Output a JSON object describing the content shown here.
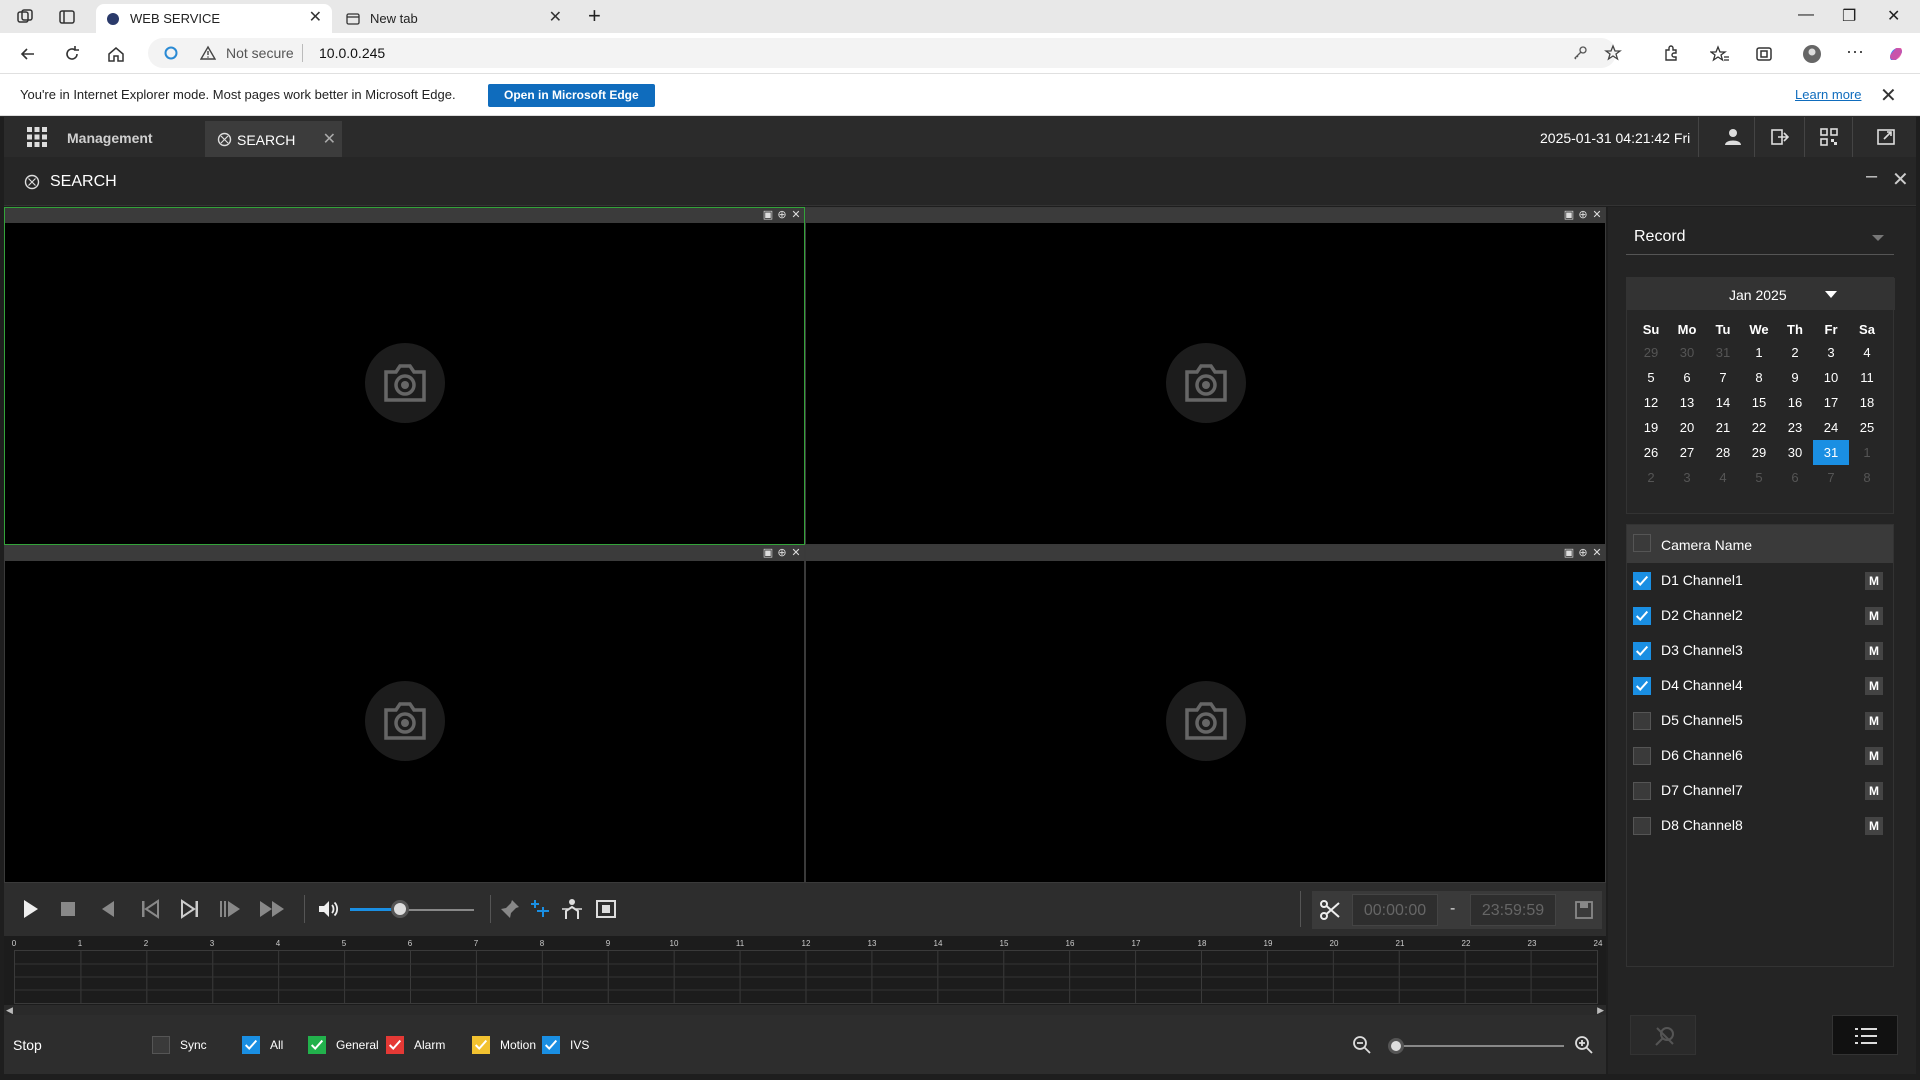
{
  "browser": {
    "tabs": [
      {
        "label": "WEB SERVICE"
      },
      {
        "label": "New tab"
      }
    ],
    "address": {
      "security": "Not secure",
      "url": "10.0.0.245"
    },
    "ie_bar": {
      "message": "You're in Internet Explorer mode. Most pages work better in Microsoft Edge.",
      "open_button": "Open in Microsoft Edge",
      "learn_more": "Learn more"
    }
  },
  "app": {
    "nav_label": "Management",
    "search_tab": "SEARCH",
    "datetime": "2025-01-31 04:21:42 Fri",
    "panel_title": "SEARCH"
  },
  "playback": {
    "start_time": "00:00:00",
    "separator": "-",
    "end_time": "23:59:59",
    "volume_fraction": 0.4,
    "status": "Stop"
  },
  "timeline": {
    "hour_labels": [
      "0",
      "1",
      "2",
      "3",
      "4",
      "5",
      "6",
      "7",
      "8",
      "9",
      "10",
      "11",
      "12",
      "13",
      "14",
      "15",
      "16",
      "17",
      "18",
      "19",
      "20",
      "21",
      "22",
      "23",
      "24"
    ]
  },
  "filters": [
    {
      "label": "Sync",
      "checked": false,
      "color": "#3a3a3a"
    },
    {
      "label": "All",
      "checked": true,
      "color": "#1a8fe3"
    },
    {
      "label": "General",
      "checked": true,
      "color": "#22b14c"
    },
    {
      "label": "Alarm",
      "checked": true,
      "color": "#e53935"
    },
    {
      "label": "Motion",
      "checked": true,
      "color": "#f2c230"
    },
    {
      "label": "IVS",
      "checked": true,
      "color": "#1a8fe3"
    }
  ],
  "right_panel": {
    "record_type": "Record",
    "month": "Jan 2025",
    "weekdays": [
      "Su",
      "Mo",
      "Tu",
      "We",
      "Th",
      "Fr",
      "Sa"
    ],
    "days": [
      {
        "d": "29",
        "o": true
      },
      {
        "d": "30",
        "o": true
      },
      {
        "d": "31",
        "o": true
      },
      {
        "d": "1"
      },
      {
        "d": "2"
      },
      {
        "d": "3"
      },
      {
        "d": "4"
      },
      {
        "d": "5"
      },
      {
        "d": "6"
      },
      {
        "d": "7"
      },
      {
        "d": "8"
      },
      {
        "d": "9"
      },
      {
        "d": "10"
      },
      {
        "d": "11"
      },
      {
        "d": "12"
      },
      {
        "d": "13"
      },
      {
        "d": "14"
      },
      {
        "d": "15"
      },
      {
        "d": "16"
      },
      {
        "d": "17"
      },
      {
        "d": "18"
      },
      {
        "d": "19"
      },
      {
        "d": "20"
      },
      {
        "d": "21"
      },
      {
        "d": "22"
      },
      {
        "d": "23"
      },
      {
        "d": "24"
      },
      {
        "d": "25"
      },
      {
        "d": "26"
      },
      {
        "d": "27"
      },
      {
        "d": "28"
      },
      {
        "d": "29"
      },
      {
        "d": "30"
      },
      {
        "d": "31",
        "sel": true
      },
      {
        "d": "1",
        "o": true
      },
      {
        "d": "2",
        "o": true
      },
      {
        "d": "3",
        "o": true
      },
      {
        "d": "4",
        "o": true
      },
      {
        "d": "5",
        "o": true
      },
      {
        "d": "6",
        "o": true
      },
      {
        "d": "7",
        "o": true
      },
      {
        "d": "8",
        "o": true
      }
    ],
    "camera_header": "Camera Name",
    "cameras": [
      {
        "name": "D1 Channel1",
        "checked": true,
        "m": "M"
      },
      {
        "name": "D2 Channel2",
        "checked": true,
        "m": "M"
      },
      {
        "name": "D3 Channel3",
        "checked": true,
        "m": "M"
      },
      {
        "name": "D4 Channel4",
        "checked": true,
        "m": "M"
      },
      {
        "name": "D5 Channel5",
        "checked": false,
        "m": "M"
      },
      {
        "name": "D6 Channel6",
        "checked": false,
        "m": "M"
      },
      {
        "name": "D7 Channel7",
        "checked": false,
        "m": "M"
      },
      {
        "name": "D8 Channel8",
        "checked": false,
        "m": "M"
      }
    ]
  }
}
